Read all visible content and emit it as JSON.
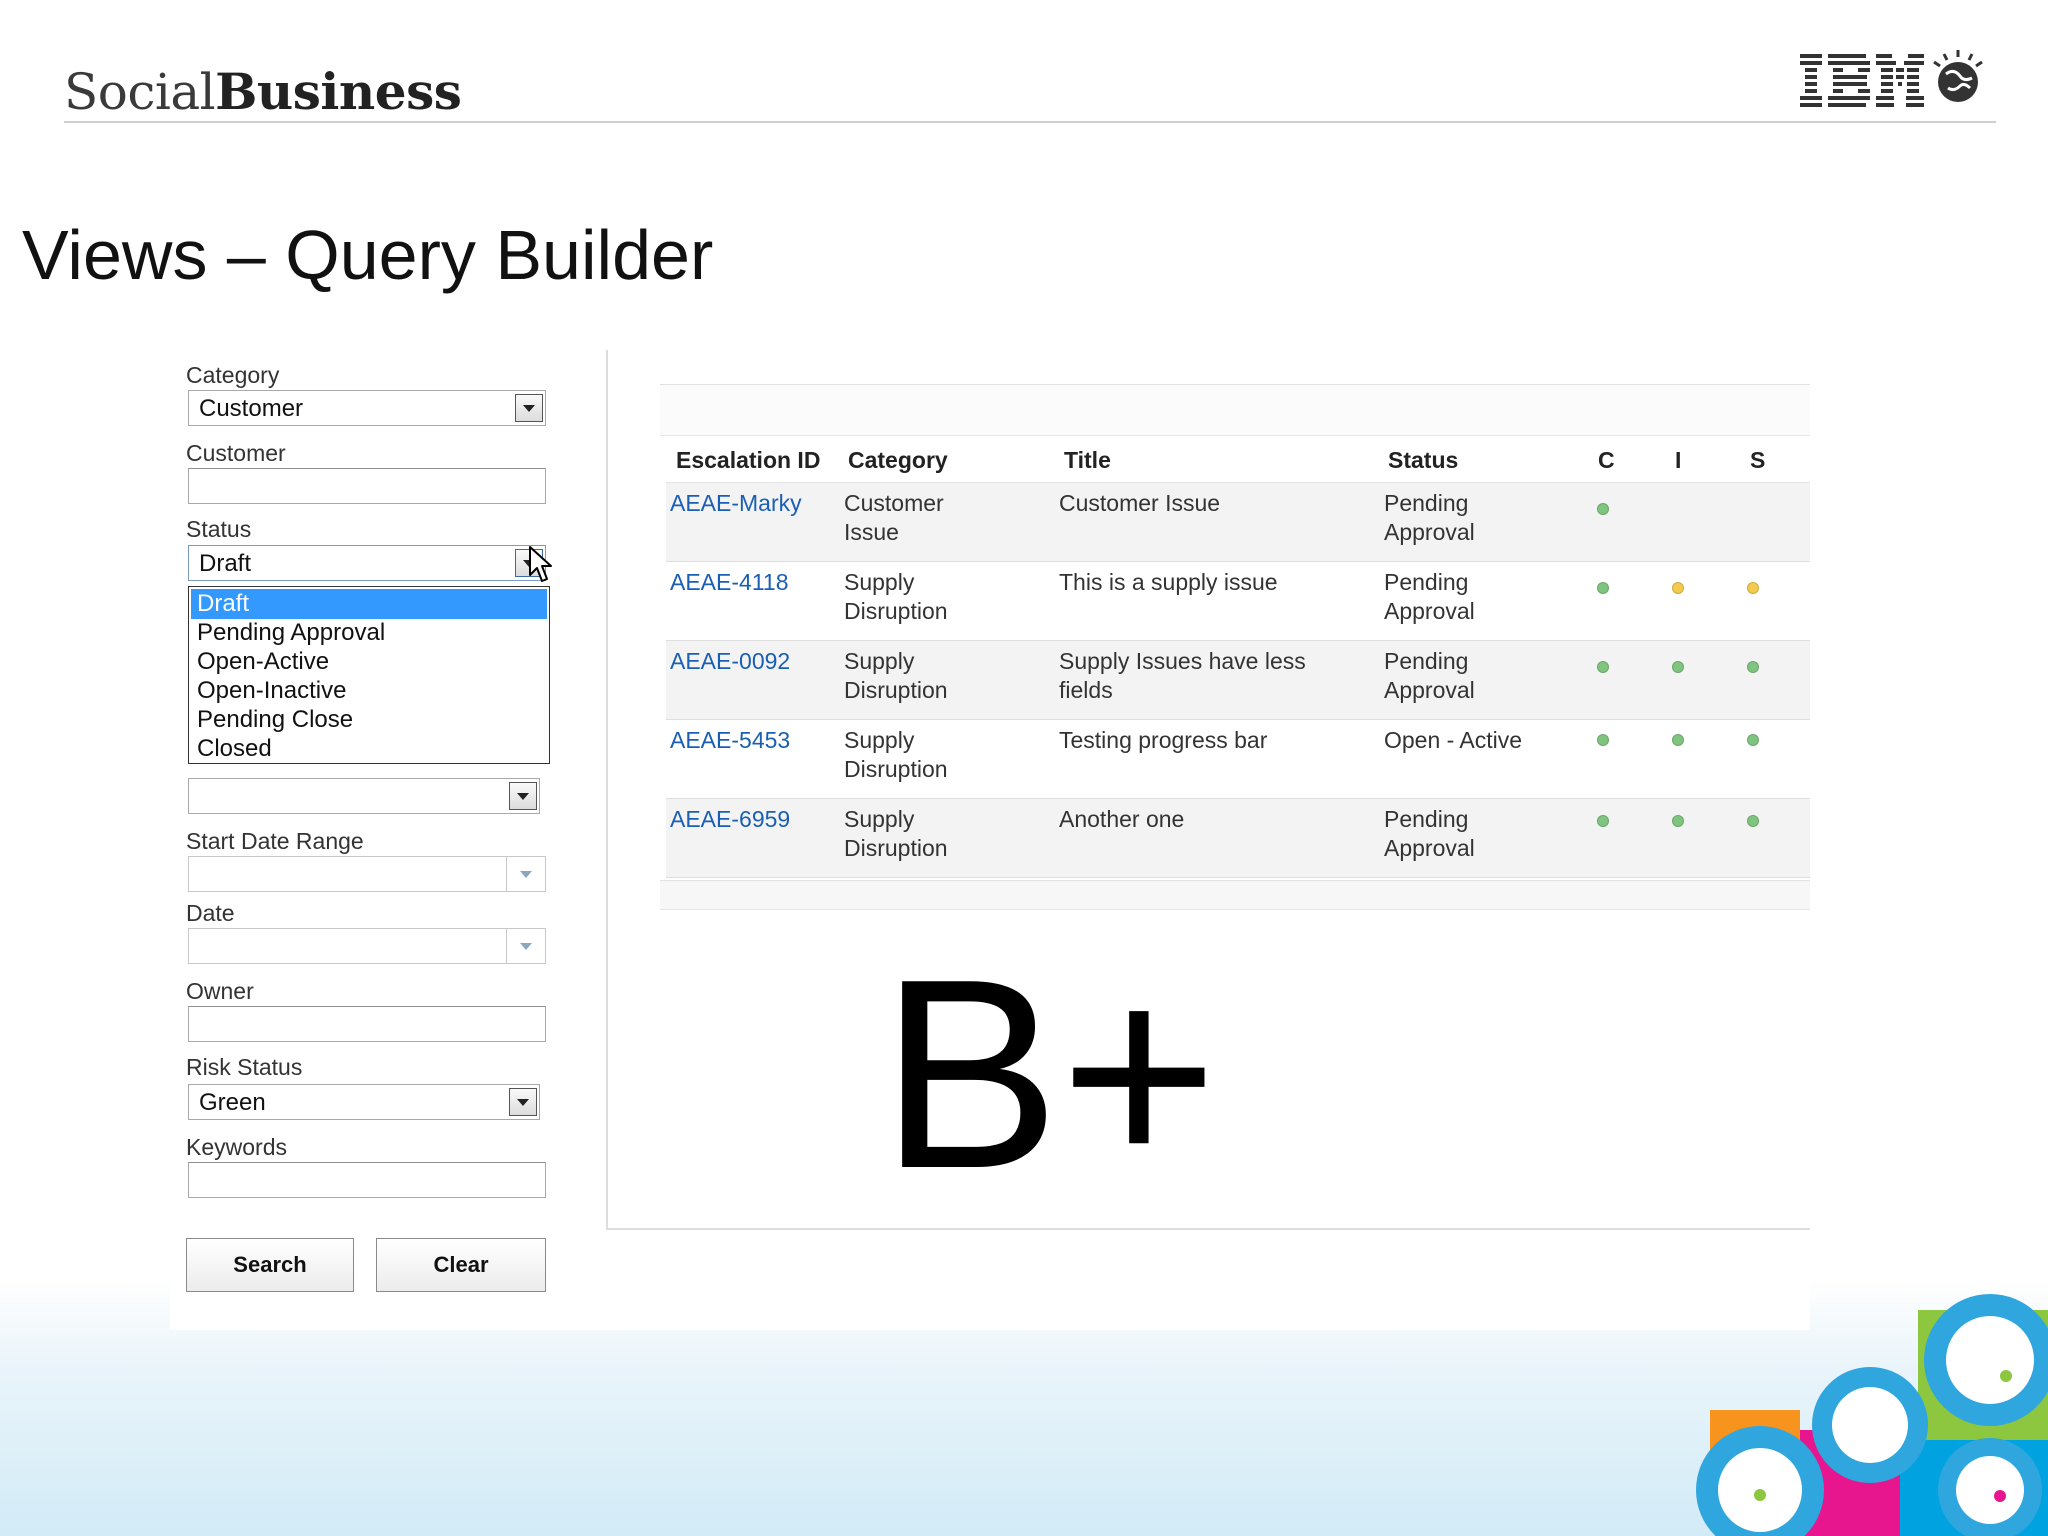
{
  "slide": {
    "brand_light": "Social",
    "brand_bold": "Business",
    "logo": "IBM",
    "title": "Views – Query Builder",
    "grade": "B+"
  },
  "filters": {
    "category": {
      "label": "Category",
      "value": "Customer"
    },
    "customer": {
      "label": "Customer",
      "value": ""
    },
    "status": {
      "label": "Status",
      "value": "Draft",
      "options": [
        "Draft",
        "Pending Approval",
        "Open-Active",
        "Open-Inactive",
        "Pending Close",
        "Closed"
      ],
      "selected_index": 0
    },
    "hidden_select": {
      "value": ""
    },
    "start_date_range": {
      "label": "Start Date Range",
      "value": ""
    },
    "date": {
      "label": "Date",
      "value": ""
    },
    "owner": {
      "label": "Owner",
      "value": ""
    },
    "risk_status": {
      "label": "Risk Status",
      "value": "Green"
    },
    "keywords": {
      "label": "Keywords",
      "value": ""
    },
    "search_label": "Search",
    "clear_label": "Clear"
  },
  "results": {
    "columns": [
      "Escalation ID",
      "Category",
      "Title",
      "Status",
      "C",
      "I",
      "S"
    ],
    "rows": [
      {
        "id": "AEAE-Marky",
        "category_1": "Customer",
        "category_2": "Issue",
        "title_1": "Customer Issue",
        "title_2": "",
        "status_1": "Pending",
        "status_2": "Approval",
        "c": "green",
        "i": "",
        "s": ""
      },
      {
        "id": "AEAE-4118",
        "category_1": "Supply",
        "category_2": "Disruption",
        "title_1": "This is a supply issue",
        "title_2": "",
        "status_1": "Pending",
        "status_2": "Approval",
        "c": "green",
        "i": "yellow",
        "s": "yellow"
      },
      {
        "id": "AEAE-0092",
        "category_1": "Supply",
        "category_2": "Disruption",
        "title_1": "Supply Issues have less",
        "title_2": "fields",
        "status_1": "Pending",
        "status_2": "Approval",
        "c": "green",
        "i": "green",
        "s": "green"
      },
      {
        "id": "AEAE-5453",
        "category_1": "Supply",
        "category_2": "Disruption",
        "title_1": "Testing progress bar",
        "title_2": "",
        "status_1": "Open - Active",
        "status_2": "",
        "c": "green",
        "i": "green",
        "s": "green"
      },
      {
        "id": "AEAE-6959",
        "category_1": "Supply",
        "category_2": "Disruption",
        "title_1": "Another one",
        "title_2": "",
        "status_1": "Pending",
        "status_2": "Approval",
        "c": "green",
        "i": "green",
        "s": "green"
      }
    ]
  },
  "colors": {
    "link": "#1a5fb4",
    "selected_option": "#3399ff",
    "risk_green": "#7fc47f",
    "risk_yellow": "#f3c94e"
  },
  "icons": {
    "dropdown": "chevron-down-icon",
    "cursor": "mouse-pointer-icon",
    "logo": "ibm-logo-icon"
  }
}
